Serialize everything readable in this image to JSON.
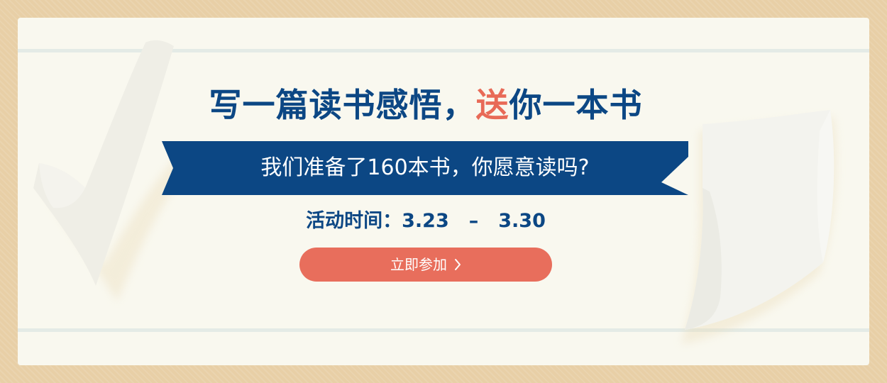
{
  "banner": {
    "headline_main": "写一篇读书感悟，",
    "headline_accent": "送",
    "headline_tail": "你一本书",
    "ribbon_text": "我们准备了160本书，你愿意读吗?",
    "date_label": "活动时间：",
    "date_start": "3.23",
    "date_separator": "–",
    "date_end": "3.30",
    "button_label": "立即参加",
    "button_icon": "chevron-right-icon"
  },
  "colors": {
    "background": "#e8cfa6",
    "card": "#f9f8ef",
    "primary_blue": "#0c4784",
    "accent_coral": "#e86a57",
    "button": "#e86e5c",
    "rule": "#e4ebe6"
  }
}
